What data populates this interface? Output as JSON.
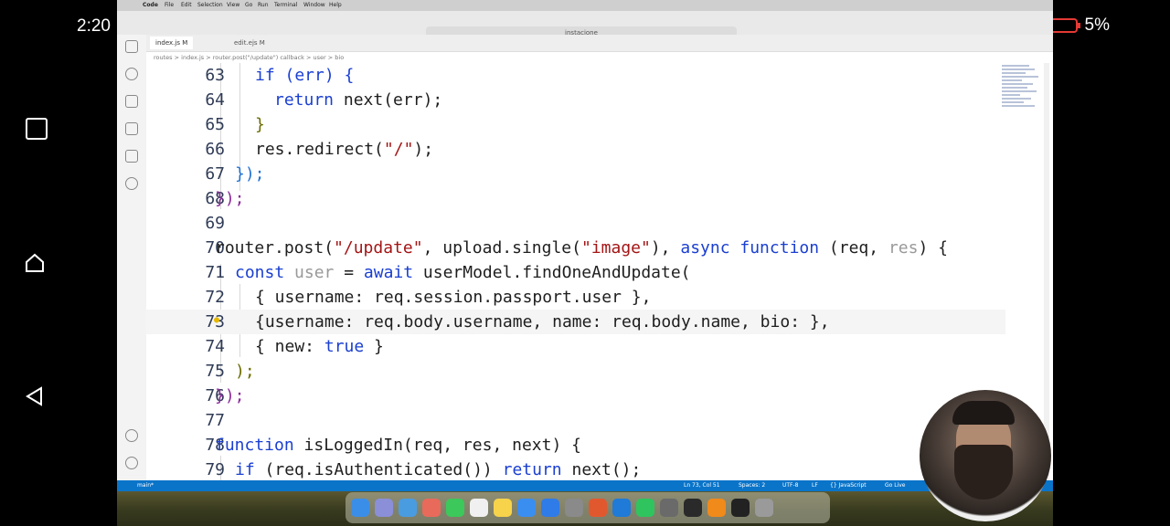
{
  "status_bar": {
    "time": "2:20",
    "battery": "5%"
  },
  "window": {
    "search_text": "instacione"
  },
  "menu": [
    "Code",
    "File",
    "Edit",
    "Selection",
    "View",
    "Go",
    "Run",
    "Terminal",
    "Window",
    "Help"
  ],
  "tabs": [
    {
      "label": "index.js M"
    },
    {
      "label": "edit.ejs M"
    }
  ],
  "breadcrumb": "routes > index.js > router.post(\"/update\") callback > user > bio",
  "code_lines": [
    {
      "n": "63",
      "indent": 2
    },
    {
      "n": "64",
      "indent": 3
    },
    {
      "n": "65",
      "indent": 3
    },
    {
      "n": "66",
      "indent": 2
    },
    {
      "n": "67",
      "indent": 1
    },
    {
      "n": "68",
      "indent": 0
    },
    {
      "n": "69",
      "indent": 0
    },
    {
      "n": "70",
      "indent": 0
    },
    {
      "n": "71",
      "indent": 1
    },
    {
      "n": "72",
      "indent": 2
    },
    {
      "n": "73",
      "indent": 2
    },
    {
      "n": "74",
      "indent": 2
    },
    {
      "n": "75",
      "indent": 1
    },
    {
      "n": "76",
      "indent": 0
    },
    {
      "n": "77",
      "indent": 0
    },
    {
      "n": "78",
      "indent": 0
    },
    {
      "n": "79",
      "indent": 1
    }
  ],
  "code": {
    "l63": "if (err) {",
    "l64a": "return",
    "l64b": " next(err);",
    "l65": "}",
    "l66a": "res.redirect(",
    "l66b": "\"/\"",
    "l66c": ");",
    "l67": "});",
    "l68": "});",
    "l70a": "router.post(",
    "l70b": "\"/update\"",
    "l70c": ", upload.single(",
    "l70d": "\"image\"",
    "l70e": "), ",
    "l70f": "async function",
    "l70g": " (req, ",
    "l70h": "res",
    "l70i": ") {",
    "l71a": "const",
    "l71b": " user",
    "l71c": " = ",
    "l71d": "await",
    "l71e": " userModel.findOneAndUpdate(",
    "l72": "{ username: req.session.passport.user },",
    "l73": "{username: req.body.username, name: req.body.name, bio: },",
    "l74a": "{ new: ",
    "l74b": "true",
    "l74c": " }",
    "l75": ");",
    "l76": "});",
    "l78a": "function",
    "l78b": " isLoggedIn(req, res, next) {",
    "l79a": "if",
    "l79b": " (req.isAuthenticated()) ",
    "l79c": "return",
    "l79d": " next();"
  },
  "statusbar": {
    "branch": "main*",
    "position": "Ln 73, Col 51",
    "spaces": "Spaces: 2",
    "encoding": "UTF-8",
    "eol": "LF",
    "language": "{} JavaScript",
    "golive": "Go Live"
  },
  "colors": {
    "keyword": "#1a3fd1",
    "string": "#a31515",
    "statusbar": "#0a74c9"
  }
}
